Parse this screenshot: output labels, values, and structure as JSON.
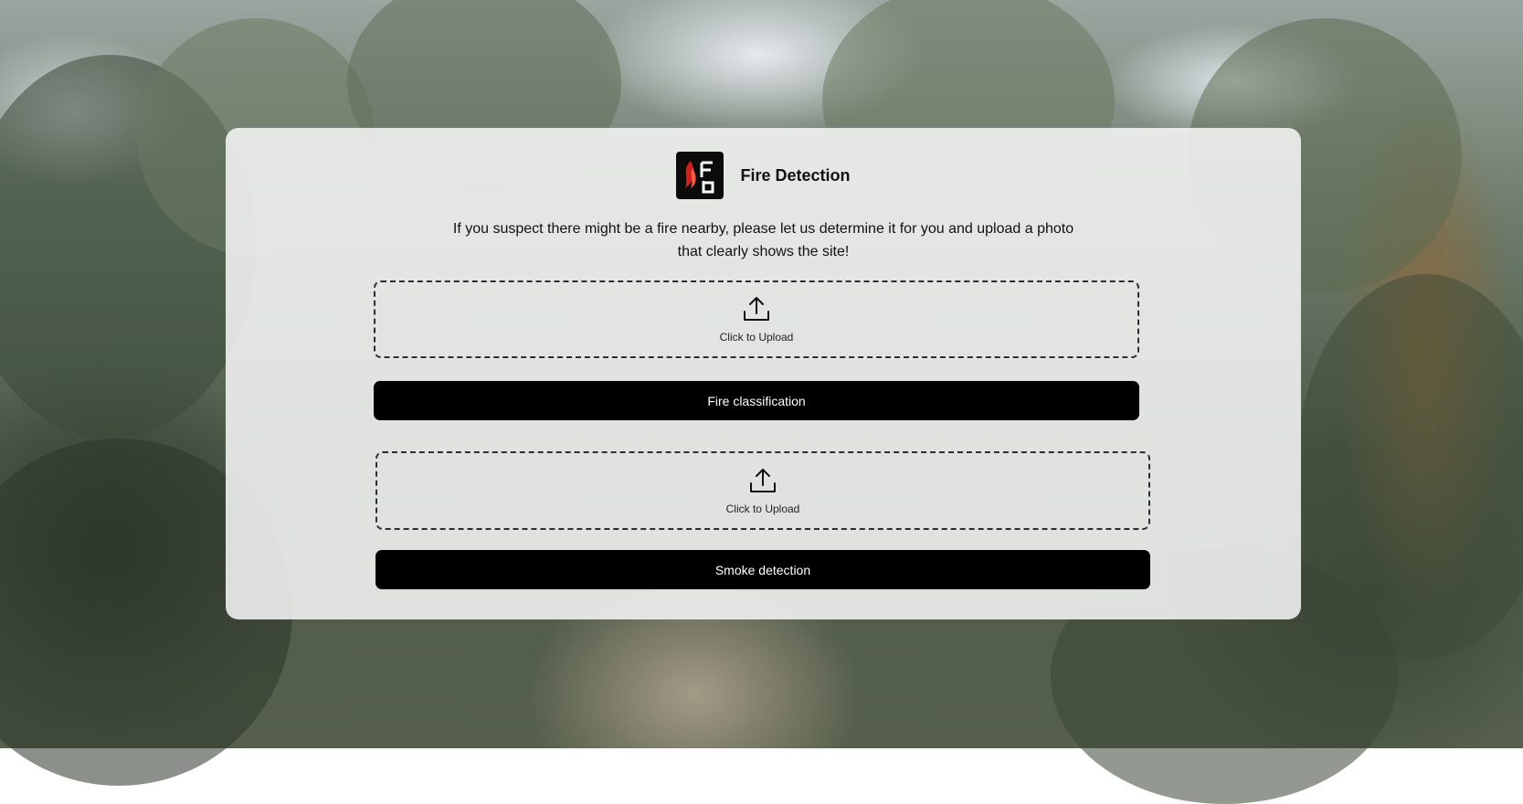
{
  "header": {
    "title": "Fire Detection",
    "logo_icon": "fire-detection-logo-icon"
  },
  "description": {
    "line1": "If you suspect there might be a fire nearby, please let us determine it for you and upload a photo",
    "line2": "that clearly shows the site!"
  },
  "fire_section": {
    "upload_label": "Click to Upload",
    "upload_icon": "upload-icon",
    "button_label": "Fire classification"
  },
  "smoke_section": {
    "upload_label": "Click to Upload",
    "upload_icon": "upload-icon",
    "button_label": "Smoke detection"
  },
  "colors": {
    "button_bg": "#000000",
    "button_text": "#ffffff",
    "card_bg": "#f5f5f5",
    "logo_bg": "#0b0b0b",
    "logo_flame": "#d0201a",
    "dashed_border": "#2a2d35"
  }
}
